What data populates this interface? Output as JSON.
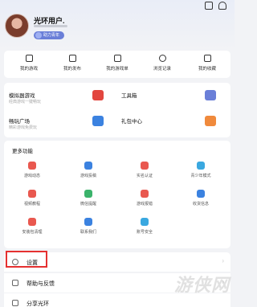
{
  "profile": {
    "username": "光环用户.",
    "level_badge": "助力青年"
  },
  "quick_actions": [
    {
      "label": "我的游戏",
      "icon": "gamepad-icon"
    },
    {
      "label": "我的发布",
      "icon": "publish-icon"
    },
    {
      "label": "我的游戏单",
      "icon": "gamelist-icon"
    },
    {
      "label": "浏览记录",
      "icon": "history-icon"
    },
    {
      "label": "我的收藏",
      "icon": "star-icon"
    }
  ],
  "tools": [
    {
      "title": "模拟器游戏",
      "subtitle": "经典游戏一键畅玩",
      "color": "#e2463f"
    },
    {
      "title": "工具箱",
      "subtitle": "",
      "color": "#6a7fd8"
    },
    {
      "title": "畅玩广场",
      "subtitle": "精彩游戏免费玩",
      "color": "#3b82e0"
    },
    {
      "title": "礼包中心",
      "subtitle": "",
      "color": "#f08a3c"
    }
  ],
  "functions": {
    "title": "更多功能",
    "items": [
      {
        "label": "游戏动态",
        "color": "#e9584f"
      },
      {
        "label": "游戏投稿",
        "color": "#3b82e0"
      },
      {
        "label": "实名认证",
        "color": "#e9584f"
      },
      {
        "label": "青少年模式",
        "color": "#3aa8e0"
      },
      {
        "label": "视频教程",
        "color": "#e9584f"
      },
      {
        "label": "微信提醒",
        "color": "#3bb36b"
      },
      {
        "label": "游戏报错",
        "color": "#e9584f"
      },
      {
        "label": "收货信息",
        "color": "#3b82e0"
      },
      {
        "label": "安装包清理",
        "color": "#e9584f"
      },
      {
        "label": "联系我们",
        "color": "#3b82e0"
      },
      {
        "label": "账号安全",
        "color": "#3aa8e0"
      }
    ]
  },
  "list": {
    "settings": "设置",
    "help": "帮助与反馈",
    "share": "分享光环"
  },
  "watermark": "游侠网"
}
